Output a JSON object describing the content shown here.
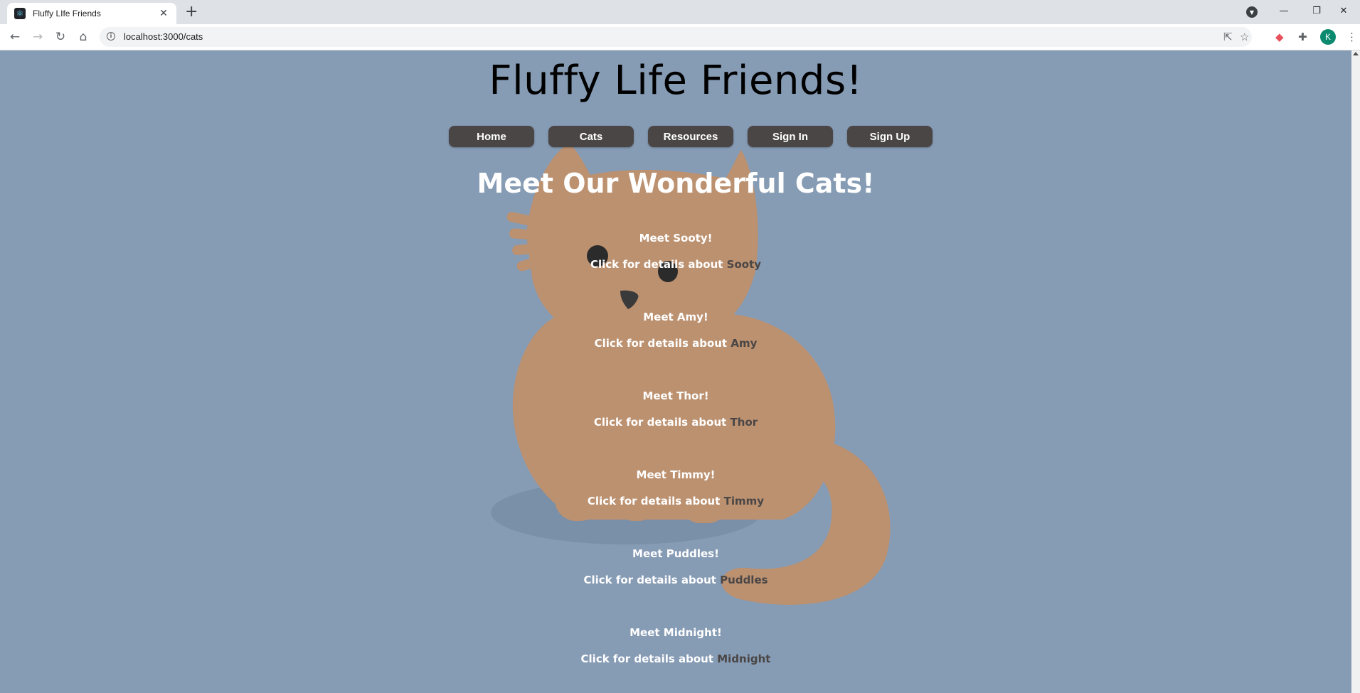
{
  "browser": {
    "tab_title": "Fluffy LIfe Friends",
    "new_tab_symbol": "+",
    "url": "localhost:3000/cats",
    "profile_initial": "K"
  },
  "site": {
    "title": "Fluffy Life Friends!",
    "nav": [
      "Home",
      "Cats",
      "Resources",
      "Sign In",
      "Sign Up"
    ],
    "heading": "Meet Our Wonderful Cats!",
    "details_prefix": "Click for details about",
    "cats": [
      {
        "meet": "Meet Sooty!",
        "name": "Sooty"
      },
      {
        "meet": "Meet Amy!",
        "name": "Amy"
      },
      {
        "meet": "Meet Thor!",
        "name": "Thor"
      },
      {
        "meet": "Meet Timmy!",
        "name": "Timmy"
      },
      {
        "meet": "Meet Puddles!",
        "name": "Puddles"
      },
      {
        "meet": "Meet Midnight!",
        "name": "Midnight"
      }
    ]
  },
  "colors": {
    "page_background": "#869bb4",
    "nav_button": "#4b4646",
    "cat_illustration": "#bc9170",
    "link_text": "#4a4646"
  }
}
